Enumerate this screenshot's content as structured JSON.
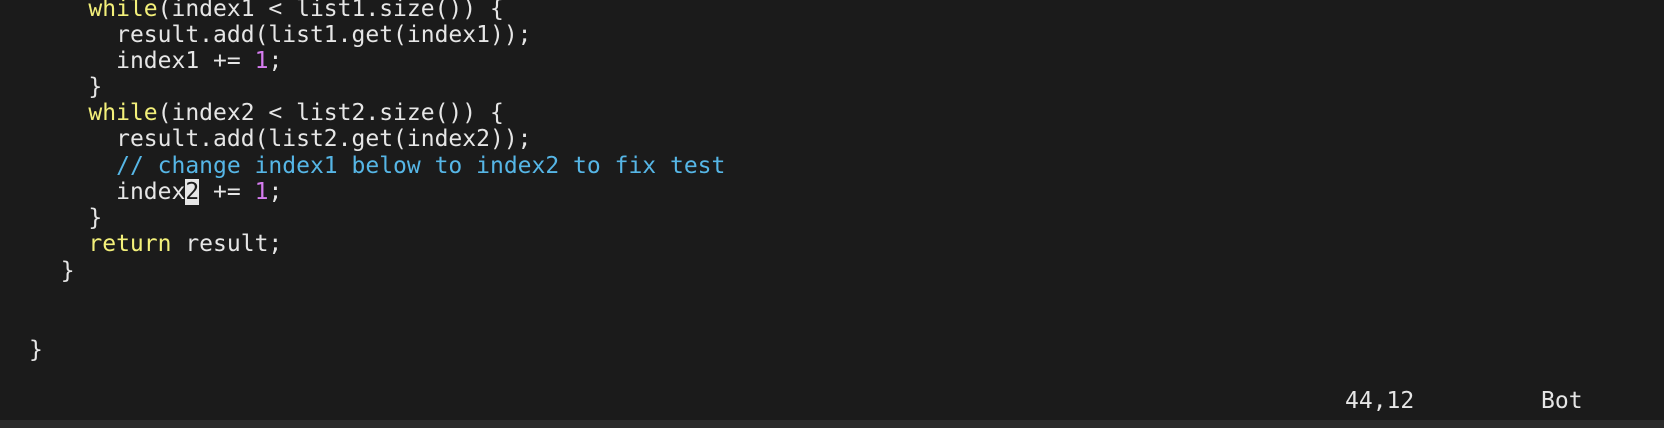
{
  "editor": {
    "lines": [
      {
        "indent": "    ",
        "kw": "while",
        "rest": "(index1 < list1.size()) {"
      },
      {
        "indent": "      ",
        "text": "result.add(list1.get(index1));"
      },
      {
        "indent": "      ",
        "before": "index1 += ",
        "num": "1",
        "after": ";"
      },
      {
        "indent": "    ",
        "text": "}"
      },
      {
        "indent": "    ",
        "kw": "while",
        "rest": "(index2 < list2.size()) {"
      },
      {
        "indent": "      ",
        "text": "result.add(list2.get(index2));"
      },
      {
        "indent": "      ",
        "comment": "// change index1 below to index2 to fix test"
      },
      {
        "indent": "      ",
        "before_cursor": "index",
        "cursor_char": "2",
        "after_cursor": " += ",
        "num": "1",
        "after": ";"
      },
      {
        "indent": "    ",
        "text": "}"
      },
      {
        "indent": "    ",
        "kw": "return",
        "rest": " result;"
      },
      {
        "indent": "  ",
        "text": "}"
      },
      {
        "indent": "",
        "text": ""
      },
      {
        "indent": "",
        "text": ""
      },
      {
        "indent": "",
        "text": "}"
      }
    ]
  },
  "statusline": {
    "position": "44,12",
    "scroll": "Bot"
  },
  "colors": {
    "background": "#1b1b1b",
    "keyword": "#f3f07a",
    "number": "#d67cf0",
    "comment": "#56b6e6",
    "text": "#e6e6e6"
  }
}
